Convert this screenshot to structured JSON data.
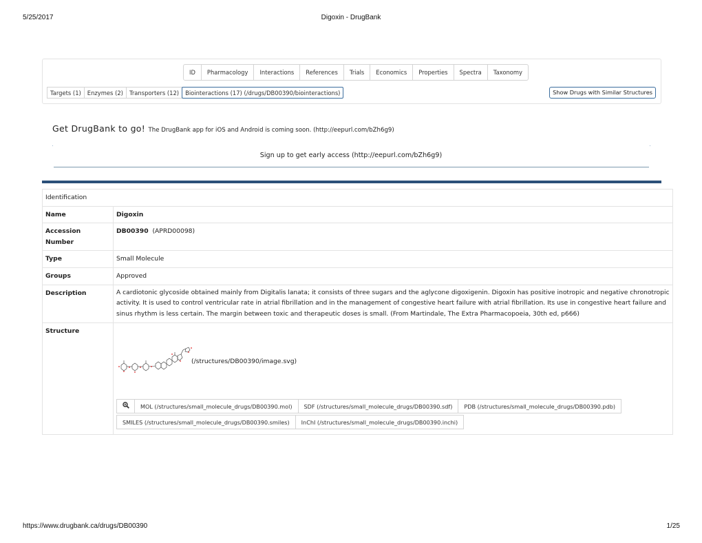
{
  "print_header": {
    "date": "5/25/2017",
    "title": "Digoxin - DrugBank"
  },
  "print_footer": {
    "url": "https://www.drugbank.ca/drugs/DB00390",
    "page": "1/25"
  },
  "nav": {
    "tabs": [
      "ID",
      "Pharmacology",
      "Interactions",
      "References",
      "Trials",
      "Economics",
      "Properties",
      "Spectra",
      "Taxonomy"
    ],
    "subtabs": [
      {
        "label": "Targets (1)",
        "active": false
      },
      {
        "label": "Enzymes (2)",
        "active": false
      },
      {
        "label": "Transporters (12)",
        "active": false
      },
      {
        "label": "Biointeractions (17) (/drugs/DB00390/biointeractions)",
        "active": true
      }
    ],
    "similar_button": "Show Drugs with Similar Structures"
  },
  "promo": {
    "title": "Get DrugBank to go!",
    "text": "The DrugBank app for iOS and Android is coming soon. (http://eepurl.com/bZh6g9)",
    "signup": "Sign up to get early access (http://eepurl.com/bZh6g9)"
  },
  "identification": {
    "section": "Identification",
    "rows": {
      "name": {
        "label": "Name",
        "value": "Digoxin"
      },
      "accession": {
        "label": "Accession Number",
        "value": "DB00390",
        "secondary": "(APRD00098)"
      },
      "type": {
        "label": "Type",
        "value": "Small Molecule"
      },
      "groups": {
        "label": "Groups",
        "value": "Approved"
      },
      "description": {
        "label": "Description",
        "value": "A cardiotonic glycoside obtained mainly from Digitalis lanata; it consists of three sugars and the aglycone digoxigenin. Digoxin has positive inotropic and negative chronotropic activity. It is used to control ventricular rate in atrial fibrillation and in the management of congestive heart failure with atrial fibrillation. Its use in congestive heart failure and sinus rhythm is less certain. The margin between toxic and therapeutic doses is small. (From Martindale, The Extra Pharmacopoeia, 30th ed, p666)"
      },
      "structure": {
        "label": "Structure",
        "image_link": "(/structures/DB00390/image.svg)",
        "zoom_icon": "magnifier-plus-icon",
        "downloads_row1": [
          "MOL (/structures/small_molecule_drugs/DB00390.mol)",
          "SDF (/structures/small_molecule_drugs/DB00390.sdf)",
          "PDB (/structures/small_molecule_drugs/DB00390.pdb)"
        ],
        "downloads_row2": [
          "SMILES (/structures/small_molecule_drugs/DB00390.smiles)",
          "InChI (/structures/small_molecule_drugs/DB00390.inchi)"
        ]
      }
    }
  }
}
